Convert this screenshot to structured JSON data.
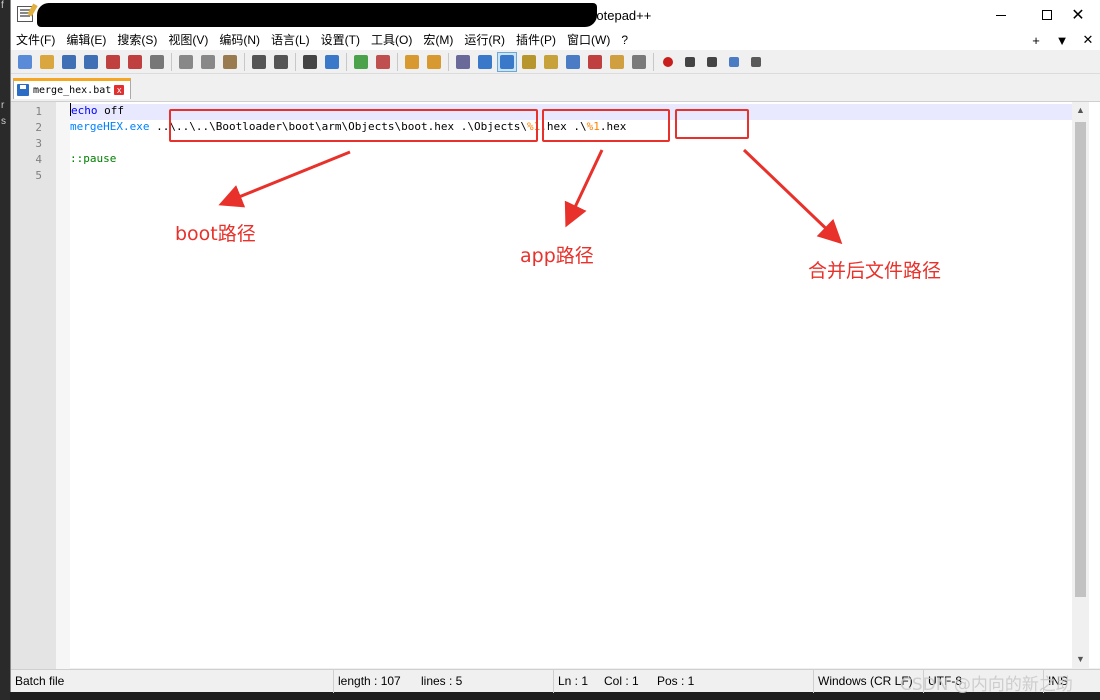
{
  "window": {
    "title_suffix": "Notepad++"
  },
  "menu": {
    "items": [
      "文件(F)",
      "编辑(E)",
      "搜索(S)",
      "视图(V)",
      "编码(N)",
      "语言(L)",
      "设置(T)",
      "工具(O)",
      "宏(M)",
      "运行(R)",
      "插件(P)",
      "窗口(W)",
      "?"
    ],
    "right": [
      "+",
      "▼",
      "✕"
    ]
  },
  "toolbar": {
    "icons": [
      "new-file-icon",
      "open-file-icon",
      "save-icon",
      "save-all-icon",
      "close-icon",
      "close-all-icon",
      "print-icon",
      "cut-icon",
      "copy-icon",
      "paste-icon",
      "undo-icon",
      "redo-icon",
      "find-icon",
      "replace-icon",
      "zoom-in-icon",
      "zoom-out-icon",
      "sync-vertical-icon",
      "sync-horizontal-icon",
      "word-wrap-icon",
      "show-all-chars-icon",
      "indent-guide-icon",
      "udl-icon",
      "doc-map-icon",
      "doc-list-icon",
      "function-list-icon",
      "folder-workspace-icon",
      "monitor-icon",
      "record-macro-icon",
      "stop-macro-icon",
      "play-macro-icon",
      "run-macro-multiple-icon",
      "save-macro-icon"
    ]
  },
  "tab": {
    "label": "merge_hex.bat",
    "close": "x"
  },
  "editor": {
    "line_numbers": [
      "1",
      "2",
      "3",
      "4",
      "5"
    ],
    "lines": [
      [
        {
          "t": "echo",
          "c": "kw"
        },
        {
          "t": " off",
          "c": "txt"
        }
      ],
      [
        {
          "t": "mergeHEX.exe",
          "c": "cmd"
        },
        {
          "t": " ..\\..\\..\\Bootloader\\boot\\arm\\Objects\\boot.hex .\\Objects\\",
          "c": "txt"
        },
        {
          "t": "%1",
          "c": "var"
        },
        {
          "t": ".hex .\\",
          "c": "txt"
        },
        {
          "t": "%1",
          "c": "var"
        },
        {
          "t": ".hex",
          "c": "txt"
        }
      ],
      [],
      [
        {
          "t": "::pause",
          "c": "lbl"
        }
      ],
      []
    ]
  },
  "annotations": {
    "boot_label": "boot路径",
    "app_label": "app路径",
    "merged_label": "合并后文件路径",
    "color": "#e8312a"
  },
  "statusbar": {
    "file_type": "Batch file",
    "length": "length : 107",
    "lines": "lines : 5",
    "ln": "Ln : 1",
    "col": "Col : 1",
    "pos": "Pos : 1",
    "eol": "Windows (CR LF)",
    "encoding": "UTF-8",
    "mode": "INS"
  },
  "watermark": "CSDN @内向的新之助"
}
